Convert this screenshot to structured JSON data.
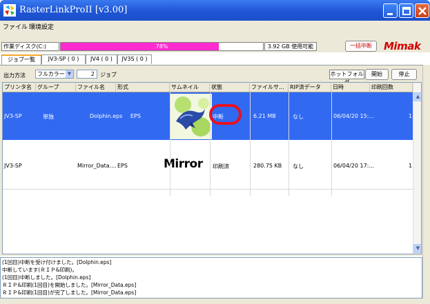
{
  "window": {
    "title": "RasterLinkProII  [v3.00]"
  },
  "menu": {
    "items": [
      "ファイル",
      "環境設定"
    ]
  },
  "disk": {
    "label": "作業ディスク(C:)",
    "progress_percent": 78,
    "progress_text": "78%",
    "usage_text": "3.92 GB 使用可能",
    "suspend_all_label": "一括中断",
    "logo_text": "Mimak"
  },
  "tabs": [
    "ジョブ一覧",
    "JV3-SP ( 0 )",
    "JV4 ( 0 )",
    "JV3S ( 0 )"
  ],
  "toolbar": {
    "output_method_label": "出力方法",
    "output_method_value": "フルカラー",
    "job_count": "2",
    "job_unit": "ジョブ",
    "hotfolder_label": "ホットフォルダ",
    "start_label": "開始",
    "stop_label": "停止"
  },
  "table": {
    "columns": [
      "プリンタ名",
      "グループ",
      "ファイル名",
      "形式",
      "サムネイル",
      "状態",
      "ファイルサ...",
      "RIP済データ",
      "日時",
      "印刷回数"
    ],
    "rows": [
      {
        "printer": "JV3-SP",
        "group": "単独",
        "filename": "Dolphin.eps",
        "format": "EPS",
        "status": "中断",
        "filesize": "6.21 MB",
        "rip": "なし",
        "datetime": "06/04/20 15:...",
        "count": "1",
        "selected": true
      },
      {
        "printer": "JV3-SP",
        "group": "",
        "filename": "Mirror_Data....",
        "format": "EPS",
        "thumb_text": "Mirror",
        "status": "印刷済",
        "filesize": "280.75 KB",
        "rip": "なし",
        "datetime": "06/04/20 17:...",
        "count": "1",
        "selected": false
      }
    ]
  },
  "log": {
    "lines": [
      "(1回目)中断を受け付けました。[Dolphin.eps]",
      "中断しています(ＲＩＰ&印刷)。",
      "(1回目)中断しました。[Dolphin.eps]",
      "ＲＩＰ&印刷(1回目)を開始しました。[Mirror_Data.eps]",
      "ＲＩＰ&印刷(1回目)が完了しました。[Mirror_Data.eps]"
    ]
  },
  "icons": {
    "minimize": "minimize-icon",
    "maximize": "maximize-icon",
    "close": "close-icon",
    "dropdown": "chevron-down-icon",
    "scroll_up": "chevron-up-icon",
    "scroll_down": "chevron-down-icon"
  },
  "colors": {
    "titlebar": "#1f56d6",
    "selection": "#3169f1",
    "progress": "#ff2bd0",
    "highlight_circle": "#e8111f",
    "logo": "#d40000"
  }
}
